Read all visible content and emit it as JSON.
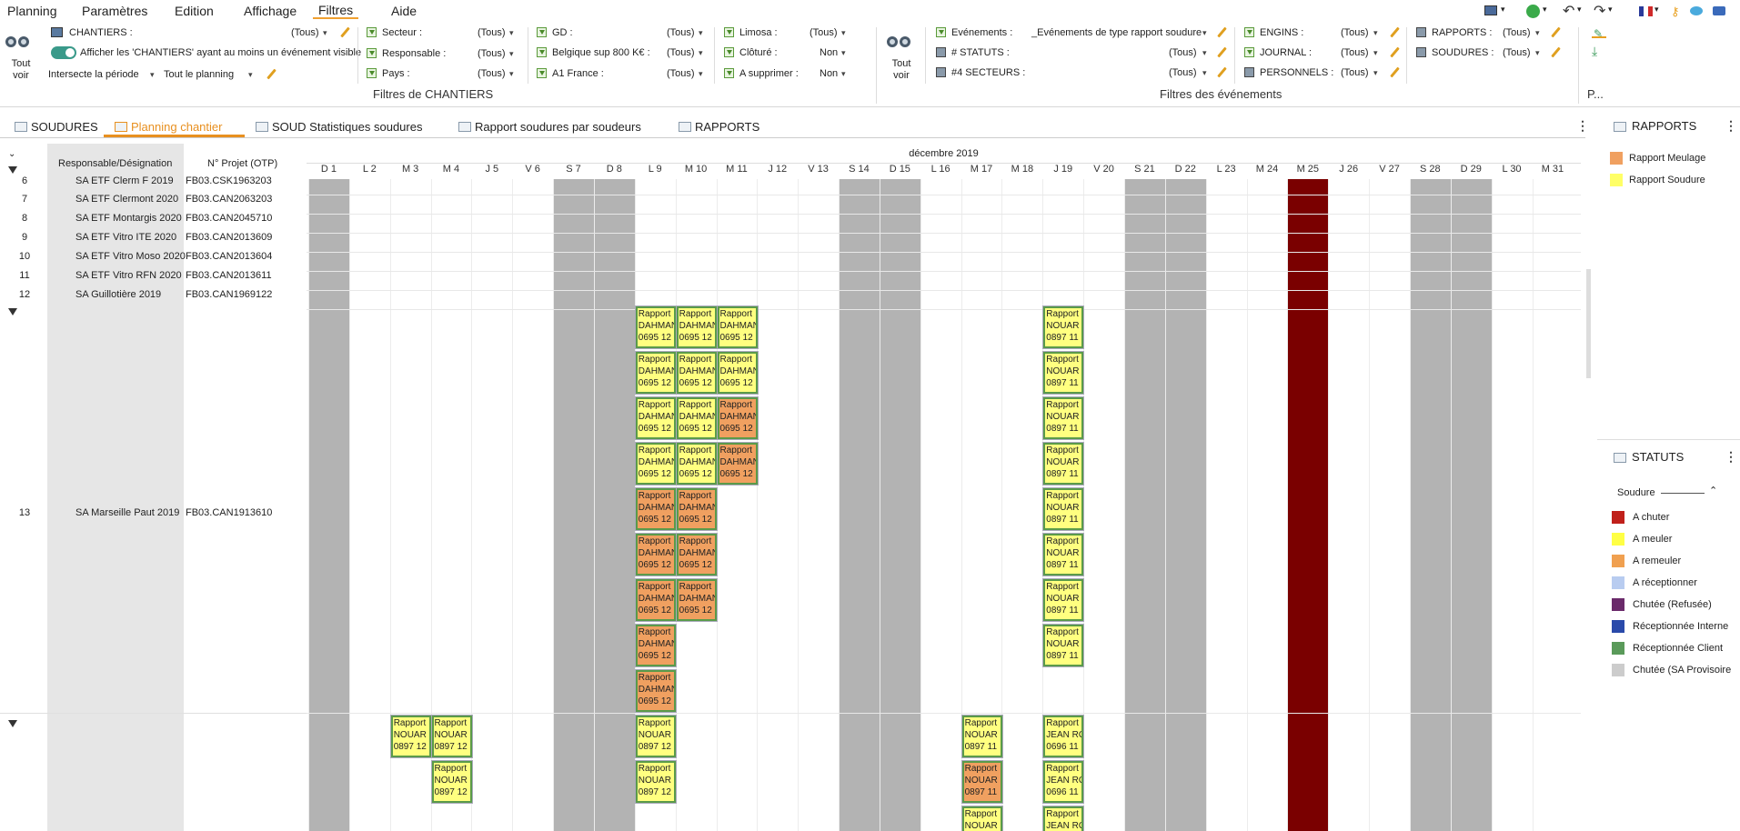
{
  "menu": [
    "Planning",
    "Paramètres",
    "Edition",
    "Affichage",
    "Filtres",
    "Aide"
  ],
  "ribbon": {
    "tout_voir_left": "Tout\nvoir",
    "chantiers_label": "CHANTIERS :",
    "chantiers_value": "(Tous)",
    "afficher_label": "Afficher les 'CHANTIERS' ayant au moins un événement visible",
    "intersecte_label": "Intersecte la période",
    "tout_planning": "Tout le planning",
    "secteur_label": "Secteur :",
    "secteur_value": "(Tous)",
    "responsable_label": "Responsable :",
    "responsable_value": "(Tous)",
    "pays_label": "Pays :",
    "pays_value": "(Tous)",
    "gd_label": "GD :",
    "gd_value": "(Tous)",
    "belgique_label": "Belgique sup 800 K€ :",
    "belgique_value": "(Tous)",
    "a1_label": "A1 France :",
    "a1_value": "(Tous)",
    "limosa_label": "Limosa :",
    "limosa_value": "(Tous)",
    "cloture_label": "Clôturé :",
    "cloture_value": "Non",
    "asupprimer_label": "A supprimer :",
    "asupprimer_value": "Non",
    "group_chantiers": "Filtres de CHANTIERS",
    "tout_voir_right": "Tout\nvoir",
    "evenements_label": "Evénements :",
    "evenements_value": "_Evénements de type rapport soudure",
    "statuts_label": "# STATUTS :",
    "statuts_value": "(Tous)",
    "secteurs_label": "#4 SECTEURS :",
    "secteurs_value": "(Tous)",
    "engins_label": "ENGINS :",
    "engins_value": "(Tous)",
    "journal_label": "JOURNAL :",
    "journal_value": "(Tous)",
    "personnels_label": "PERSONNELS :",
    "personnels_value": "(Tous)",
    "rapports_label": "RAPPORTS :",
    "rapports_value": "(Tous)",
    "soudures_label": "SOUDURES :",
    "soudures_value": "(Tous)",
    "group_evenements": "Filtres des événements",
    "group_p": "P..."
  },
  "tabs": [
    "SOUDURES",
    "Planning chantier",
    "SOUD Statistiques soudures",
    "Rapport soudures par soudeurs",
    "RAPPORTS"
  ],
  "grid": {
    "col_designation": "Responsable/Désignation",
    "col_otp": "N° Projet (OTP)",
    "month": "décembre 2019",
    "rows": [
      {
        "num": "6",
        "des": "SA ETF Clerm F 2019",
        "otp": "FB03.CSK1963203"
      },
      {
        "num": "7",
        "des": "SA ETF Clermont 2020",
        "otp": "FB03.CAN2063203"
      },
      {
        "num": "8",
        "des": "SA ETF Montargis 2020",
        "otp": "FB03.CAN2045710"
      },
      {
        "num": "9",
        "des": "SA ETF Vitro ITE 2020",
        "otp": "FB03.CAN2013609"
      },
      {
        "num": "10",
        "des": "SA ETF Vitro Moso 2020",
        "otp": "FB03.CAN2013604"
      },
      {
        "num": "11",
        "des": "SA ETF Vitro RFN 2020",
        "otp": "FB03.CAN2013611"
      },
      {
        "num": "12",
        "des": "SA Guillotière 2019",
        "otp": "FB03.CAN1969122"
      },
      {
        "num": "13",
        "des": "SA Marseille Paut 2019",
        "otp": "FB03.CAN1913610"
      }
    ],
    "days": [
      "D 1",
      "L 2",
      "M 3",
      "M 4",
      "J 5",
      "V 6",
      "S 7",
      "D 8",
      "L 9",
      "M 10",
      "M 11",
      "J 12",
      "V 13",
      "S 14",
      "D 15",
      "L 16",
      "M 17",
      "M 18",
      "J 19",
      "V 20",
      "S 21",
      "D 22",
      "L 23",
      "M 24",
      "M 25",
      "J 26",
      "V 27",
      "S 28",
      "D 29",
      "L 30",
      "M 31"
    ],
    "card_title": "Rapport"
  },
  "cards": [
    {
      "day": 8,
      "slot": 0,
      "block": "a",
      "c": "y",
      "l2": "DAHMAN",
      "l3": "0695 12"
    },
    {
      "day": 9,
      "slot": 0,
      "block": "a",
      "c": "y",
      "l2": "DAHMAN",
      "l3": "0695 12"
    },
    {
      "day": 10,
      "slot": 0,
      "block": "a",
      "c": "y",
      "l2": "DAHMAN",
      "l3": "0695 12"
    },
    {
      "day": 18,
      "slot": 0,
      "block": "a",
      "c": "y",
      "l2": "NOUAR",
      "l3": "0897 11"
    },
    {
      "day": 8,
      "slot": 1,
      "block": "a",
      "c": "y",
      "l2": "DAHMAN",
      "l3": "0695 12"
    },
    {
      "day": 9,
      "slot": 1,
      "block": "a",
      "c": "y",
      "l2": "DAHMAN",
      "l3": "0695 12"
    },
    {
      "day": 10,
      "slot": 1,
      "block": "a",
      "c": "y",
      "l2": "DAHMAN",
      "l3": "0695 12"
    },
    {
      "day": 18,
      "slot": 1,
      "block": "a",
      "c": "y",
      "l2": "NOUAR",
      "l3": "0897 11"
    },
    {
      "day": 8,
      "slot": 2,
      "block": "a",
      "c": "y",
      "l2": "DAHMAN",
      "l3": "0695 12"
    },
    {
      "day": 9,
      "slot": 2,
      "block": "a",
      "c": "y",
      "l2": "DAHMAN",
      "l3": "0695 12"
    },
    {
      "day": 10,
      "slot": 2,
      "block": "a",
      "c": "o",
      "l2": "DAHMAN",
      "l3": "0695 12"
    },
    {
      "day": 18,
      "slot": 2,
      "block": "a",
      "c": "y",
      "l2": "NOUAR",
      "l3": "0897 11"
    },
    {
      "day": 8,
      "slot": 3,
      "block": "a",
      "c": "y",
      "l2": "DAHMAN",
      "l3": "0695 12"
    },
    {
      "day": 9,
      "slot": 3,
      "block": "a",
      "c": "y",
      "l2": "DAHMAN",
      "l3": "0695 12"
    },
    {
      "day": 10,
      "slot": 3,
      "block": "a",
      "c": "o",
      "l2": "DAHMAN",
      "l3": "0695 12"
    },
    {
      "day": 18,
      "slot": 3,
      "block": "a",
      "c": "y",
      "l2": "NOUAR",
      "l3": "0897 11"
    },
    {
      "day": 8,
      "slot": 4,
      "block": "a",
      "c": "o",
      "l2": "DAHMAN",
      "l3": "0695 12"
    },
    {
      "day": 9,
      "slot": 4,
      "block": "a",
      "c": "o",
      "l2": "DAHMAN",
      "l3": "0695 12"
    },
    {
      "day": 18,
      "slot": 4,
      "block": "a",
      "c": "y",
      "l2": "NOUAR",
      "l3": "0897 11"
    },
    {
      "day": 8,
      "slot": 5,
      "block": "a",
      "c": "o",
      "l2": "DAHMAN",
      "l3": "0695 12"
    },
    {
      "day": 9,
      "slot": 5,
      "block": "a",
      "c": "o",
      "l2": "DAHMAN",
      "l3": "0695 12"
    },
    {
      "day": 18,
      "slot": 5,
      "block": "a",
      "c": "y",
      "l2": "NOUAR",
      "l3": "0897 11"
    },
    {
      "day": 8,
      "slot": 6,
      "block": "a",
      "c": "o",
      "l2": "DAHMAN",
      "l3": "0695 12"
    },
    {
      "day": 9,
      "slot": 6,
      "block": "a",
      "c": "o",
      "l2": "DAHMAN",
      "l3": "0695 12"
    },
    {
      "day": 18,
      "slot": 6,
      "block": "a",
      "c": "y",
      "l2": "NOUAR",
      "l3": "0897 11"
    },
    {
      "day": 8,
      "slot": 7,
      "block": "a",
      "c": "o",
      "l2": "DAHMAN",
      "l3": "0695 12"
    },
    {
      "day": 18,
      "slot": 7,
      "block": "a",
      "c": "y",
      "l2": "NOUAR",
      "l3": "0897 11"
    },
    {
      "day": 8,
      "slot": 8,
      "block": "a",
      "c": "o",
      "l2": "DAHMAN",
      "l3": "0695 12"
    },
    {
      "day": 2,
      "slot": 0,
      "block": "b",
      "c": "y",
      "l2": "NOUAR",
      "l3": "0897 12"
    },
    {
      "day": 3,
      "slot": 0,
      "block": "b",
      "c": "y",
      "l2": "NOUAR",
      "l3": "0897 12"
    },
    {
      "day": 8,
      "slot": 0,
      "block": "b",
      "c": "y",
      "l2": "NOUAR",
      "l3": "0897 12"
    },
    {
      "day": 16,
      "slot": 0,
      "block": "b",
      "c": "y",
      "l2": "NOUAR",
      "l3": "0897 11"
    },
    {
      "day": 18,
      "slot": 0,
      "block": "b",
      "c": "y",
      "l2": "JEAN RO",
      "l3": "0696 11"
    },
    {
      "day": 3,
      "slot": 1,
      "block": "b",
      "c": "y",
      "l2": "NOUAR",
      "l3": "0897 12"
    },
    {
      "day": 8,
      "slot": 1,
      "block": "b",
      "c": "y",
      "l2": "NOUAR",
      "l3": "0897 12"
    },
    {
      "day": 16,
      "slot": 1,
      "block": "b",
      "c": "o",
      "l2": "NOUAR",
      "l3": "0897 11"
    },
    {
      "day": 18,
      "slot": 1,
      "block": "b",
      "c": "y",
      "l2": "JEAN RO",
      "l3": "0696 11"
    },
    {
      "day": 16,
      "slot": 2,
      "block": "b",
      "c": "y",
      "l2": "NOUAR",
      "l3": ""
    },
    {
      "day": 18,
      "slot": 2,
      "block": "b",
      "c": "y",
      "l2": "JEAN RO",
      "l3": ""
    }
  ],
  "rapports_panel": {
    "title": "RAPPORTS",
    "items": [
      {
        "label": "Rapport Meulage",
        "color": "#f0a060"
      },
      {
        "label": "Rapport Soudure",
        "color": "#ffff66"
      }
    ]
  },
  "statuts_panel": {
    "title": "STATUTS",
    "group": "Soudure",
    "items": [
      {
        "label": "A chuter",
        "color": "#c0201a"
      },
      {
        "label": "A meuler",
        "color": "#ffff44"
      },
      {
        "label": "A remeuler",
        "color": "#f0a050"
      },
      {
        "label": "A réceptionner",
        "color": "#b8ccf0"
      },
      {
        "label": "Chutée (Refusée)",
        "color": "#6a2a6a"
      },
      {
        "label": "Réceptionnée Interne",
        "color": "#2a4aaa"
      },
      {
        "label": "Réceptionnée Client",
        "color": "#5a9a5a"
      },
      {
        "label": "Chutée (SA Provisoire",
        "color": "#cccccc"
      }
    ]
  },
  "colors": {
    "weekend": "#b3b3b3",
    "holiday": "#7a0000",
    "accent": "#e89020"
  }
}
